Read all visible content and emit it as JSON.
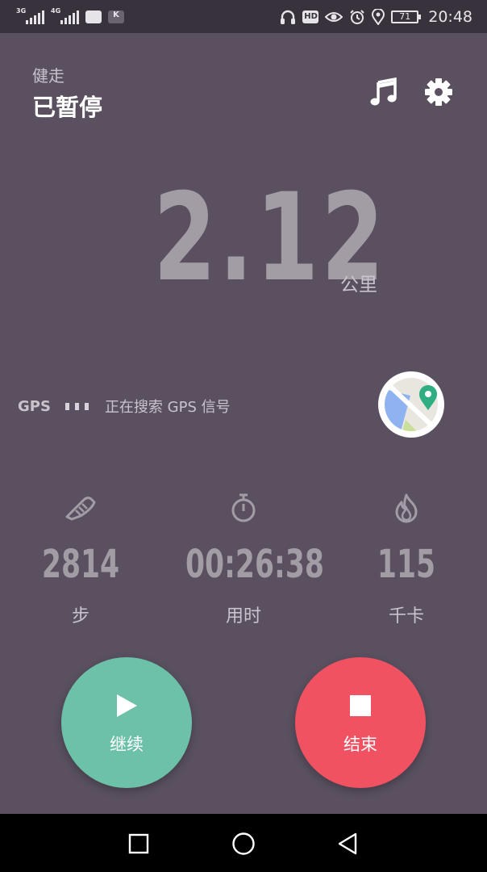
{
  "status_bar": {
    "network_1": "3G",
    "network_2": "4G",
    "time": "20:48",
    "battery": "71",
    "hd_badge": "HD",
    "icons": [
      "signal-icon",
      "signal-icon",
      "message-icon",
      "app-k-icon",
      "headphones-icon",
      "hd-icon",
      "eye-icon",
      "alarm-icon",
      "location-icon",
      "battery-icon"
    ]
  },
  "header": {
    "sport_type": "健走",
    "state": "已暂停",
    "icons": [
      "music-note-icon",
      "gear-icon"
    ]
  },
  "distance": {
    "value": "2.12",
    "unit": "公里"
  },
  "gps": {
    "label": "GPS",
    "status": "正在搜索 GPS 信号"
  },
  "stats": {
    "steps": {
      "value": "2814",
      "label": "步",
      "icon": "shoe-icon"
    },
    "time": {
      "value": "00:26:38",
      "label": "用时",
      "icon": "stopwatch-icon"
    },
    "calories": {
      "value": "115",
      "label": "千卡",
      "icon": "flame-icon"
    }
  },
  "actions": {
    "resume_label": "继续",
    "end_label": "结束"
  },
  "colors": {
    "background": "#5a5060",
    "resume": "#6cc1a8",
    "end": "#f05262",
    "value_text": "#a29ca5"
  }
}
